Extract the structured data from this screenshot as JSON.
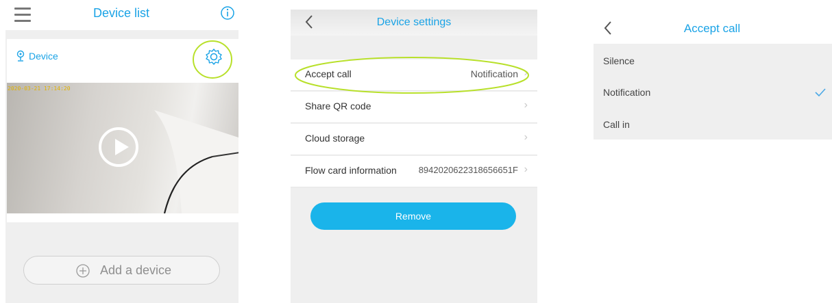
{
  "panel1": {
    "title": "Device list",
    "device_label": "Device",
    "timestamp": "2020-03-21 17:14:20",
    "add_device_label": "Add a device"
  },
  "panel2": {
    "title": "Device settings",
    "rows": [
      {
        "label": "Accept call",
        "value": "Notification"
      },
      {
        "label": "Share QR code",
        "value": ""
      },
      {
        "label": "Cloud storage",
        "value": ""
      },
      {
        "label": "Flow card information",
        "value": "8942020622318656651F"
      }
    ],
    "remove_label": "Remove"
  },
  "panel3": {
    "title": "Accept call",
    "options": [
      {
        "label": "Silence",
        "selected": false
      },
      {
        "label": "Notification",
        "selected": true
      },
      {
        "label": "Call in",
        "selected": false
      }
    ]
  },
  "colors": {
    "accent": "#1aa3e6",
    "highlight_circle": "#b8e02a",
    "remove_button": "#1ab4ea"
  },
  "icons": [
    "menu-icon",
    "info-icon",
    "location-pin-icon",
    "gear-icon",
    "play-icon",
    "plus-circle-icon",
    "back-chevron-icon",
    "chevron-right-icon",
    "checkmark-icon"
  ]
}
